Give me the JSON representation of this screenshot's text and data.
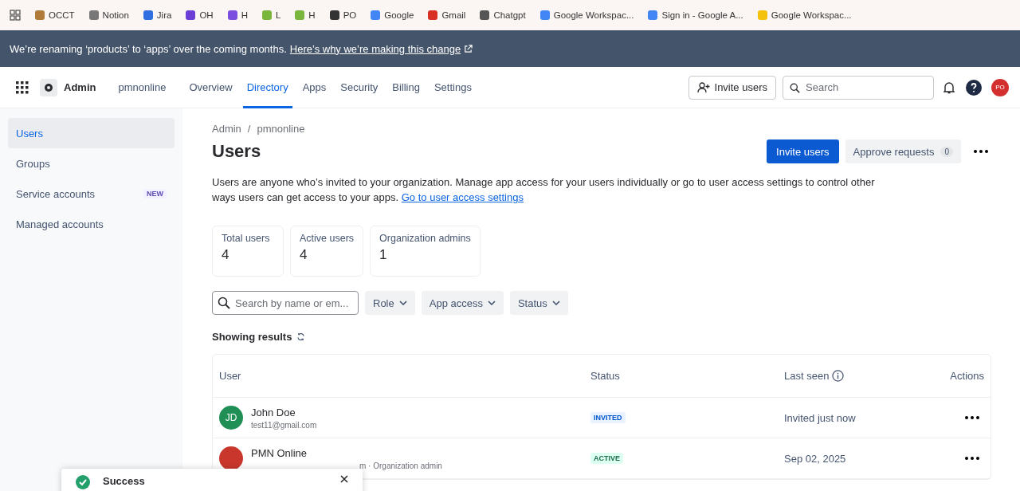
{
  "bookmarks": [
    {
      "label": "OCCT",
      "color": "#b07a3a"
    },
    {
      "label": "Notion",
      "color": "#777777"
    },
    {
      "label": "Jira",
      "color": "#2f6fe0"
    },
    {
      "label": "OH",
      "color": "#6b3fd6"
    },
    {
      "label": "H",
      "color": "#7a4fe0"
    },
    {
      "label": "L",
      "color": "#7ab53c"
    },
    {
      "label": "H",
      "color": "#7ab53c"
    },
    {
      "label": "PO",
      "color": "#333333"
    },
    {
      "label": "Google",
      "color": "#4285f4"
    },
    {
      "label": "Gmail",
      "color": "#d93025"
    },
    {
      "label": "Chatgpt",
      "color": "#555555"
    },
    {
      "label": "Google Workspac...",
      "color": "#4285f4"
    },
    {
      "label": "Sign in - Google A...",
      "color": "#4285f4"
    },
    {
      "label": "Google Workspac...",
      "color": "#f4c20d"
    }
  ],
  "banner": {
    "text": "We’re renaming ‘products’ to ‘apps’ over the coming months.",
    "link": "Here’s why we’re making this change"
  },
  "nav": {
    "product": "Admin",
    "org": "pmnonline",
    "tabs": [
      {
        "label": "Overview",
        "selected": false
      },
      {
        "label": "Directory",
        "selected": true
      },
      {
        "label": "Apps",
        "selected": false
      },
      {
        "label": "Security",
        "selected": false
      },
      {
        "label": "Billing",
        "selected": false
      },
      {
        "label": "Settings",
        "selected": false
      }
    ],
    "invite": "Invite users",
    "search": {
      "placeholder": "Search"
    },
    "avatar": "PO"
  },
  "sidebar": {
    "items": [
      {
        "label": "Users",
        "selected": true
      },
      {
        "label": "Groups",
        "selected": false
      },
      {
        "label": "Service accounts",
        "selected": false,
        "badge": "NEW"
      },
      {
        "label": "Managed accounts",
        "selected": false
      }
    ]
  },
  "breadcrumb": {
    "items": [
      "Admin",
      "pmnonline"
    ],
    "separator": "/"
  },
  "title": "Users",
  "actions": {
    "primary": "Invite users",
    "secondary": "Approve requests",
    "count": "0"
  },
  "description": {
    "text": "Users are anyone who’s invited to your organization. Manage app access for your users individually or go to user access settings to control other ways users can get access to your apps.",
    "link": "Go to user access settings"
  },
  "stats": [
    {
      "label": "Total users",
      "value": "4"
    },
    {
      "label": "Active users",
      "value": "4"
    },
    {
      "label": "Organization admins",
      "value": "1"
    }
  ],
  "filters": {
    "search": {
      "placeholder": "Search by name or em..."
    },
    "dropdowns": [
      "Role",
      "App access",
      "Status"
    ]
  },
  "results_label": "Showing results",
  "table": {
    "columns": [
      "User",
      "Status",
      "Last seen",
      "Actions"
    ],
    "rows": [
      {
        "initials": "JD",
        "color": "#1f8f55",
        "name": "John Doe",
        "sub": "test11@gmail.com",
        "status": "INVITED",
        "kind": "invited",
        "last_seen": "Invited just now"
      },
      {
        "initials": "",
        "color": "#c9372c",
        "name": "PMN Online",
        "sub": "m · Organization admin",
        "status": "ACTIVE",
        "kind": "active",
        "last_seen": "Sep 02, 2025"
      }
    ]
  },
  "toast": {
    "title": "Success"
  }
}
